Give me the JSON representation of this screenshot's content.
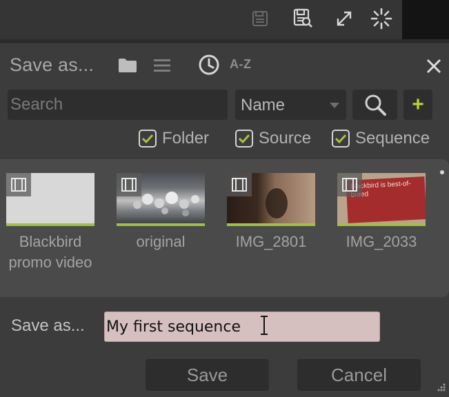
{
  "toolbar": {
    "icons": [
      "save-sequence-icon",
      "save-as-icon",
      "expand-icon",
      "loading-spinner-icon"
    ]
  },
  "dialog": {
    "title": "Save as...",
    "sort_az_label": "A-Z",
    "search": {
      "placeholder": "Search",
      "value": ""
    },
    "sort_select": {
      "value": "Name"
    },
    "add_label": "+",
    "filters": [
      {
        "label": "Folder",
        "checked": true
      },
      {
        "label": "Source",
        "checked": true
      },
      {
        "label": "Sequence",
        "checked": true
      }
    ],
    "items": [
      {
        "name": "Blackbird promo video",
        "kind": "video"
      },
      {
        "name": "original",
        "kind": "video"
      },
      {
        "name": "IMG_2801",
        "kind": "video"
      },
      {
        "name": "IMG_2033",
        "kind": "video",
        "thumb_text": "Blackbird is best-of-breed"
      }
    ],
    "save_as_label": "Save as...",
    "filename": "My first sequence",
    "save_button": "Save",
    "cancel_button": "Cancel"
  },
  "colors": {
    "accent_green": "#a2c23a",
    "plus_green": "#b8d432",
    "input_bg": "#d6bfbf"
  }
}
